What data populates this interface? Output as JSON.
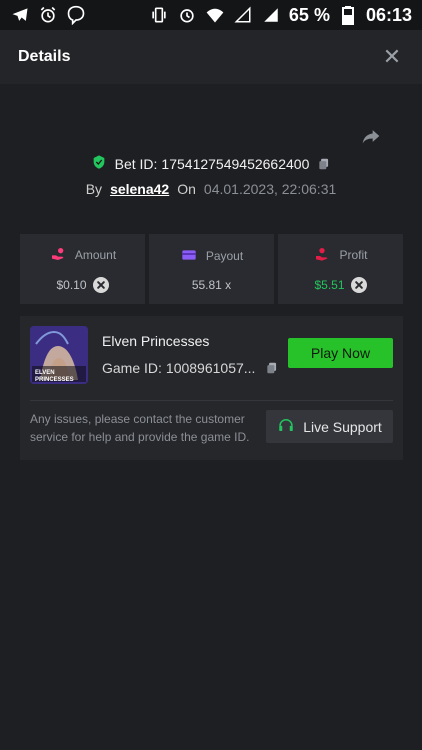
{
  "statusbar": {
    "battery": "65 %",
    "time": "06:13"
  },
  "header": {
    "title": "Details"
  },
  "bet": {
    "id_label": "Bet ID:",
    "id_value": "1754127549452662400",
    "by_label": "By",
    "username": "selena42",
    "on_label": "On",
    "datetime": "04.01.2023, 22:06:31"
  },
  "stats": [
    {
      "label": "Amount",
      "value": "$0.10"
    },
    {
      "label": "Payout",
      "value": "55.81 x"
    },
    {
      "label": "Profit",
      "value": "$5.51"
    }
  ],
  "game": {
    "title": "Elven Princesses",
    "id_label": "Game ID:",
    "id_value": "1008961057...",
    "thumb_text": "ELVEN PRINCESSES",
    "play_label": "Play Now"
  },
  "support": {
    "text": "Any issues, please contact the customer service for help and provide the game ID.",
    "button_label": "Live Support"
  },
  "colors": {
    "accent_green": "#27c22a",
    "profit_green": "#22c55e",
    "background": "#1e1f22"
  }
}
